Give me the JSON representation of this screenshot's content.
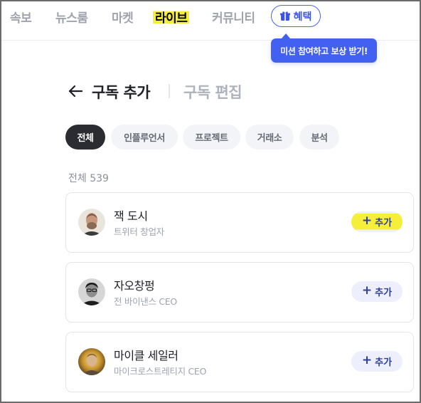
{
  "nav": {
    "items": [
      {
        "label": "속보"
      },
      {
        "label": "뉴스룸"
      },
      {
        "label": "마켓"
      },
      {
        "label": "라이브"
      },
      {
        "label": "커뮤니티"
      }
    ],
    "active": "라이브",
    "benefit_label": "혜택",
    "benefit_icon": "gift-icon"
  },
  "tooltip": {
    "text": "미션 참여하고 보상 받기!"
  },
  "header": {
    "back_icon": "arrow-left-icon",
    "title": "구독 추가",
    "subtitle": "구독 편집"
  },
  "tabs": [
    {
      "label": "전체"
    },
    {
      "label": "인플루언서"
    },
    {
      "label": "프로젝트"
    },
    {
      "label": "거래소"
    },
    {
      "label": "분석"
    }
  ],
  "active_tab": "전체",
  "total_label": "전체 539",
  "people": [
    {
      "name": "잭 도시",
      "role": "트위터 창업자",
      "add_label": "추가"
    },
    {
      "name": "자오창펑",
      "role": "전 바이낸스 CEO",
      "add_label": "추가"
    },
    {
      "name": "마이클 세일러",
      "role": "마이크로스트레티지 CEO",
      "add_label": "추가"
    }
  ],
  "colors": {
    "highlight": "#f6ef3a",
    "accent_blue": "#4361f0",
    "active_tab_bg": "#2b2c31",
    "add_button_bg": "#edf0fc"
  }
}
